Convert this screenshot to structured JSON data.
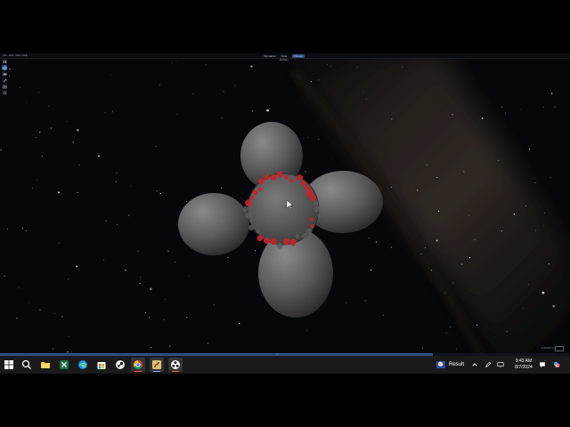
{
  "app": {
    "menu": [
      "File",
      "Edit",
      "View",
      "Help"
    ],
    "tabs": [
      {
        "label": "Simulation",
        "active": false
      },
      {
        "label": "Solar System",
        "active": false
      },
      {
        "label": "Planets",
        "active": true
      }
    ],
    "tools": [
      {
        "name": "pause-icon"
      },
      {
        "name": "globe-icon"
      },
      {
        "name": "planet-icon"
      },
      {
        "name": "brush-icon"
      },
      {
        "name": "camera-icon"
      },
      {
        "name": "zoom-icon"
      }
    ],
    "timebar": {
      "label": "1x",
      "progress": 0.76
    },
    "hud": {
      "label": "2.00000 Gyr",
      "accent": "#2d4f83"
    }
  },
  "taskbar": {
    "apps": [
      {
        "name": "windows-start-icon",
        "glyph": "start",
        "active": false
      },
      {
        "name": "search-icon",
        "glyph": "search",
        "active": false
      },
      {
        "name": "file-explorer-icon",
        "glyph": "folder",
        "active": false
      },
      {
        "name": "excel-icon",
        "glyph": "excel",
        "active": false
      },
      {
        "name": "edge-icon",
        "glyph": "edge",
        "active": false
      },
      {
        "name": "store-icon",
        "glyph": "store",
        "active": false
      },
      {
        "name": "steam-icon",
        "glyph": "steam",
        "active": false
      },
      {
        "name": "chrome-icon",
        "glyph": "chrome",
        "active": true
      },
      {
        "name": "universe-sandbox-icon",
        "glyph": "sandbox",
        "active": true
      },
      {
        "name": "obs-icon",
        "glyph": "obs",
        "active": true
      }
    ],
    "result_label": "Result",
    "time": "9:43 AM",
    "date": "8/7/2024"
  }
}
